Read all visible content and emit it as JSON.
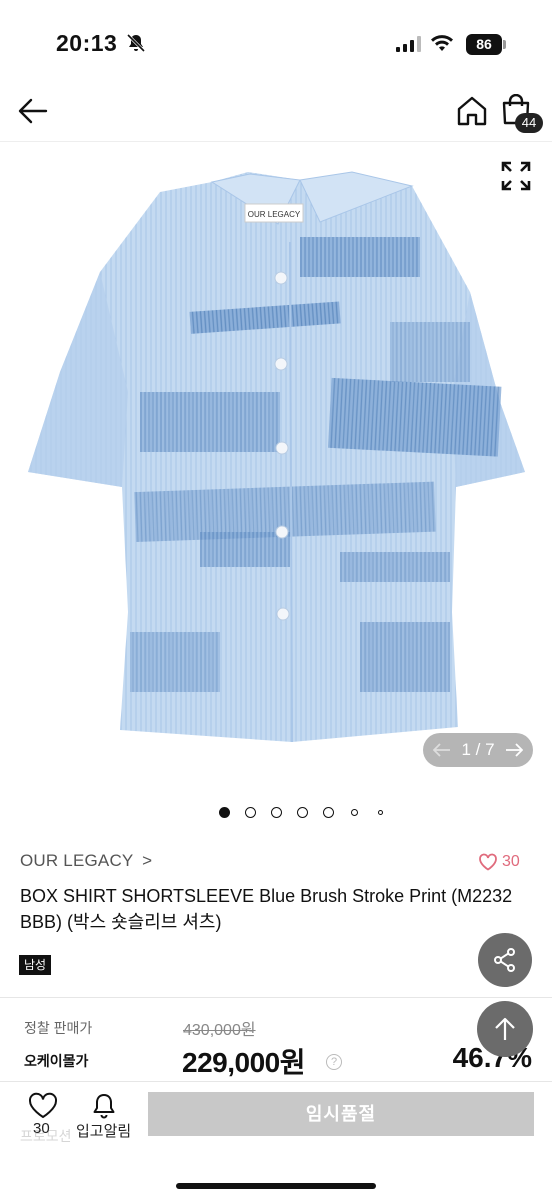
{
  "status_bar": {
    "time": "20:13",
    "battery": "86"
  },
  "header": {
    "cart_count": "44"
  },
  "gallery": {
    "label_on_shirt": "OUR LEGACY",
    "counter": "1 / 7",
    "current_index": 1,
    "total": 7
  },
  "product": {
    "brand": "OUR LEGACY",
    "brand_arrow": ">",
    "likes": "30",
    "title": "BOX SHIRT SHORTSLEEVE Blue Brush Stroke Print (M2232 BBB) (박스 숏슬리브 셔츠)",
    "tag": "남성"
  },
  "pricing": {
    "original_label": "정찰 판매가",
    "original_price": "430,000원",
    "sale_label": "오케이몰가",
    "sale_price": "229,000원",
    "help": "?",
    "discount": "46.7%"
  },
  "bottom_bar": {
    "wish_count": "30",
    "alarm_label": "입고알림",
    "soldout_label": "임시품절",
    "ghost_text": "프로모션"
  },
  "colors": {
    "accent_like": "#e06b7d",
    "disabled_button": "#c8c8c8",
    "shirt_base": "#b9d3ee",
    "shirt_stroke": "#5f8fc4"
  }
}
